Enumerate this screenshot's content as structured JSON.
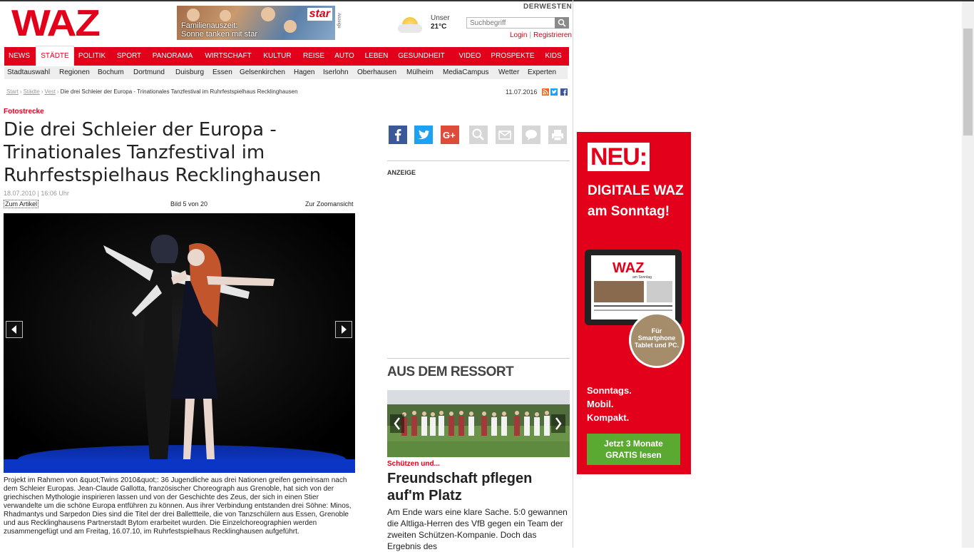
{
  "header": {
    "logo": "WAZ",
    "ad_banner": {
      "brand": "star",
      "text_line1": "Familienauszeit:",
      "text_line2": "Sonne tanken mit star",
      "label": "Anzeige"
    },
    "weather": {
      "line1": "Unser",
      "line2": "21°C",
      "icon": "sun-cloud-icon"
    },
    "network": "DERWESTEN",
    "search": {
      "placeholder": "Suchbegriff"
    },
    "login": "Login",
    "register": "Registrieren"
  },
  "main_nav": [
    {
      "label": "NEWS"
    },
    {
      "label": "STÄDTE",
      "active": true
    },
    {
      "label": "POLITIK"
    },
    {
      "label": "SPORT"
    },
    {
      "label": "PANORAMA"
    },
    {
      "label": "WIRTSCHAFT"
    },
    {
      "label": "KULTUR"
    },
    {
      "label": "REISE"
    },
    {
      "label": "AUTO"
    },
    {
      "label": "LEBEN"
    },
    {
      "label": "GESUNDHEIT"
    },
    {
      "label": "VIDEO"
    },
    {
      "label": "PROSPEKTE"
    },
    {
      "label": "KIDS"
    }
  ],
  "sub_nav": [
    "Stadtauswahl",
    "Regionen",
    "Bochum",
    "Dortmund",
    "Duisburg",
    "Essen",
    "Gelsenkirchen",
    "Hagen",
    "Iserlohn",
    "Oberhausen",
    "Mülheim",
    "MediaCampus",
    "Wetter",
    "Experten"
  ],
  "breadcrumb": {
    "items": [
      "Start",
      "Städte",
      "Vest"
    ],
    "current": "Die drei Schleier der Europa - Trinationales Tanzfestival im Ruhrfestspielhaus Recklinghausen"
  },
  "page_date": "11.07.2016",
  "article": {
    "kicker": "Fotostrecke",
    "title": "Die drei Schleier der Europa - Trinationales Tanzfestival im Ruhrfestspielhaus Recklinghausen",
    "meta": "18.07.2010 | 16:06 Uhr",
    "gallery": {
      "back_link": "Zum Artikel",
      "counter": "Bild 5 von 20",
      "zoom_link": "Zur Zoomansicht"
    },
    "caption": "Projekt im Rahmen von &quot;Twins 2010&quot;: 36 Jugendliche aus drei Nationen greifen gemeinsam nach dem Schleier Europas. Jean-Claude Gallotta, französischer Choreograph aus Grenoble, hat sich von der griechischen Mythologie inspirieren lassen und von der Geschichte des Zeus, der sich in einen Stier verwandelte um die schöne Europa entführen zu können. Aus ihrer Verbindung entstanden drei Söhne: Minos, Rhadmantys und Sarpedon Dies sind die Titel der drei Ballettteile, die von Tanzschülern aus Essen, Grenoble und aus Recklinghausens Partnerstadt Bytom erarbeitet wurden. Die Einzelchoreographien werden zusammengefügt und am Freitag, 16.07.10, im Ruhrfestspielhaus Recklinghausen aufgeführt."
  },
  "share_icons": [
    {
      "name": "facebook-icon",
      "color": "#3b5998"
    },
    {
      "name": "twitter-icon",
      "color": "#1da1f2"
    },
    {
      "name": "google-plus-icon",
      "color": "#dd4b39"
    },
    {
      "name": "zoom-icon",
      "color": "#cfcfcf"
    },
    {
      "name": "mail-icon",
      "color": "#cfcfcf"
    },
    {
      "name": "comment-icon",
      "color": "#cfcfcf"
    },
    {
      "name": "print-icon",
      "color": "#cfcfcf"
    }
  ],
  "sidebar": {
    "ad_label": "ANZEIGE",
    "ressort_title": "AUS DEM RESSORT",
    "teaser": {
      "kicker": "Schützen und...",
      "title": "Freundschaft pflegen auf'm Platz",
      "text": "Am Ende wars eine klare Sache. 5:0 gewannen die Altliga-Herren des VfB gegen ein Team der zweiten Schützen-Kompanie. Doch das Ergebnis des"
    }
  },
  "side_ad": {
    "badge": "NEU:",
    "headline_line1": "DIGITALE WAZ",
    "headline_line2": "am Sonntag!",
    "circle_line1": "Für",
    "circle_line2": "Smartphone",
    "circle_line3": "Tablet und PC.",
    "tagline_line1": "Sonntags.",
    "tagline_line2": "Mobil.",
    "tagline_line3": "Kompakt.",
    "cta_line1": "Jetzt 3 Monate",
    "cta_line2": "GRATIS lesen",
    "tablet_logo": "WAZ",
    "tablet_sub": "am Sonntag"
  },
  "colors": {
    "brand": "#e2001a",
    "cta": "#5aaa31"
  }
}
